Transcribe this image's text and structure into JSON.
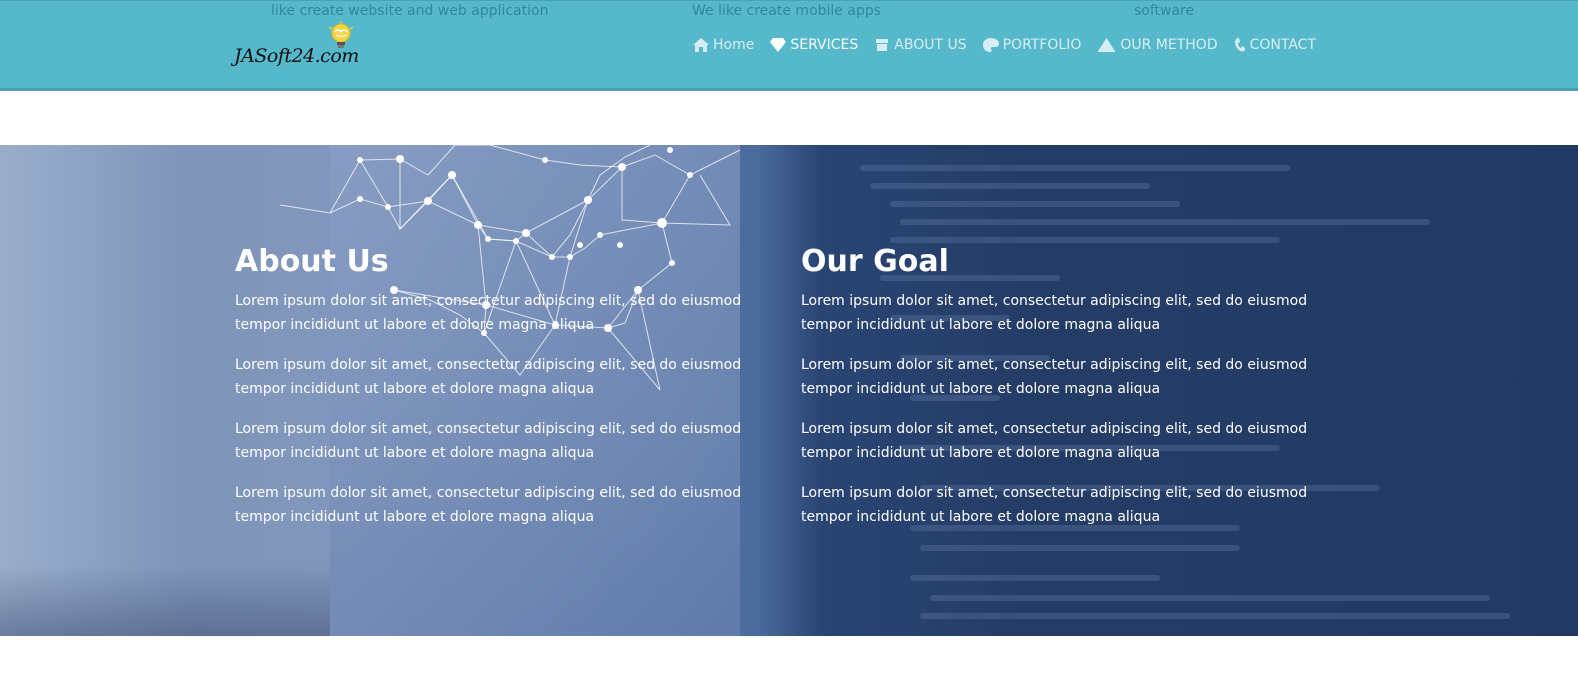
{
  "header": {
    "taglines": [
      "like create website and web application",
      "We like create mobile apps",
      "software"
    ],
    "logo_text": "JASoft24.com",
    "nav": [
      {
        "label": "Home",
        "icon": "home-icon"
      },
      {
        "label": "SERVICES",
        "icon": "diamond-icon",
        "active": true
      },
      {
        "label": "ABOUT US",
        "icon": "graduation-cap-icon"
      },
      {
        "label": "PORTFOLIO",
        "icon": "palette-icon"
      },
      {
        "label": "OUR METHOD",
        "icon": "mountain-icon"
      },
      {
        "label": "CONTACT",
        "icon": "phone-icon"
      }
    ]
  },
  "about": {
    "title": "About Us",
    "paragraphs": [
      "Lorem ipsum dolor sit amet, consectetur adipiscing elit, sed do eiusmod tempor incididunt ut labore et dolore magna aliqua",
      "Lorem ipsum dolor sit amet, consectetur adipiscing elit, sed do eiusmod tempor incididunt ut labore et dolore magna aliqua",
      "Lorem ipsum dolor sit amet, consectetur adipiscing elit, sed do eiusmod tempor incididunt ut labore et dolore magna aliqua",
      "Lorem ipsum dolor sit amet, consectetur adipiscing elit, sed do eiusmod tempor incididunt ut labore et dolore magna aliqua"
    ]
  },
  "goal": {
    "title": "Our Goal",
    "paragraphs": [
      "Lorem ipsum dolor sit amet, consectetur adipiscing elit, sed do eiusmod tempor incididunt ut labore et dolore magna aliqua",
      "Lorem ipsum dolor sit amet, consectetur adipiscing elit, sed do eiusmod tempor incididunt ut labore et dolore magna aliqua",
      "Lorem ipsum dolor sit amet, consectetur adipiscing elit, sed do eiusmod tempor incididunt ut labore et dolore magna aliqua",
      "Lorem ipsum dolor sit amet, consectetur adipiscing elit, sed do eiusmod tempor incididunt ut labore et dolore magna aliqua"
    ]
  },
  "colors": {
    "navbar": "#55b8cb",
    "tagline": "#2f8a9c",
    "nav_text": "#d6eef3",
    "nav_active": "#ffffff",
    "hero_dark": "#223a63"
  }
}
